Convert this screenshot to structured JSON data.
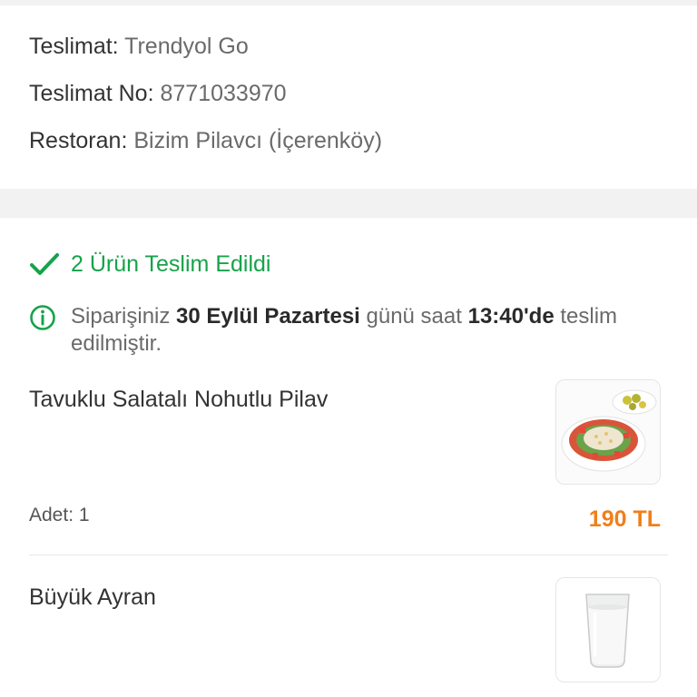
{
  "delivery": {
    "company_label": "Teslimat:",
    "company_value": "Trendyol Go",
    "number_label": "Teslimat No:",
    "number_value": "8771033970",
    "restaurant_label": "Restoran:",
    "restaurant_value": "Bizim Pilavcı (İçerenköy)"
  },
  "status": {
    "icon": "checkmark-icon",
    "text": "2 Ürün Teslim Edildi",
    "color": "#16a34a"
  },
  "notice": {
    "icon": "info-icon",
    "part1": "Siparişiniz ",
    "date": "30 Eylül Pazartesi",
    "part2": " günü saat ",
    "time": "13:40'de",
    "part3": " teslim edilmiştir."
  },
  "items": [
    {
      "name": "Tavuklu Salatalı Nohutlu Pilav",
      "image": "rice-salad-plate-image",
      "quantity": "Adet: 1",
      "price": "190 TL"
    },
    {
      "name": "Büyük Ayran",
      "image": "ayran-glass-image"
    }
  ],
  "colors": {
    "accent_green": "#16a34a",
    "price_orange": "#f07f1a",
    "band_gray": "#f2f2f2"
  }
}
